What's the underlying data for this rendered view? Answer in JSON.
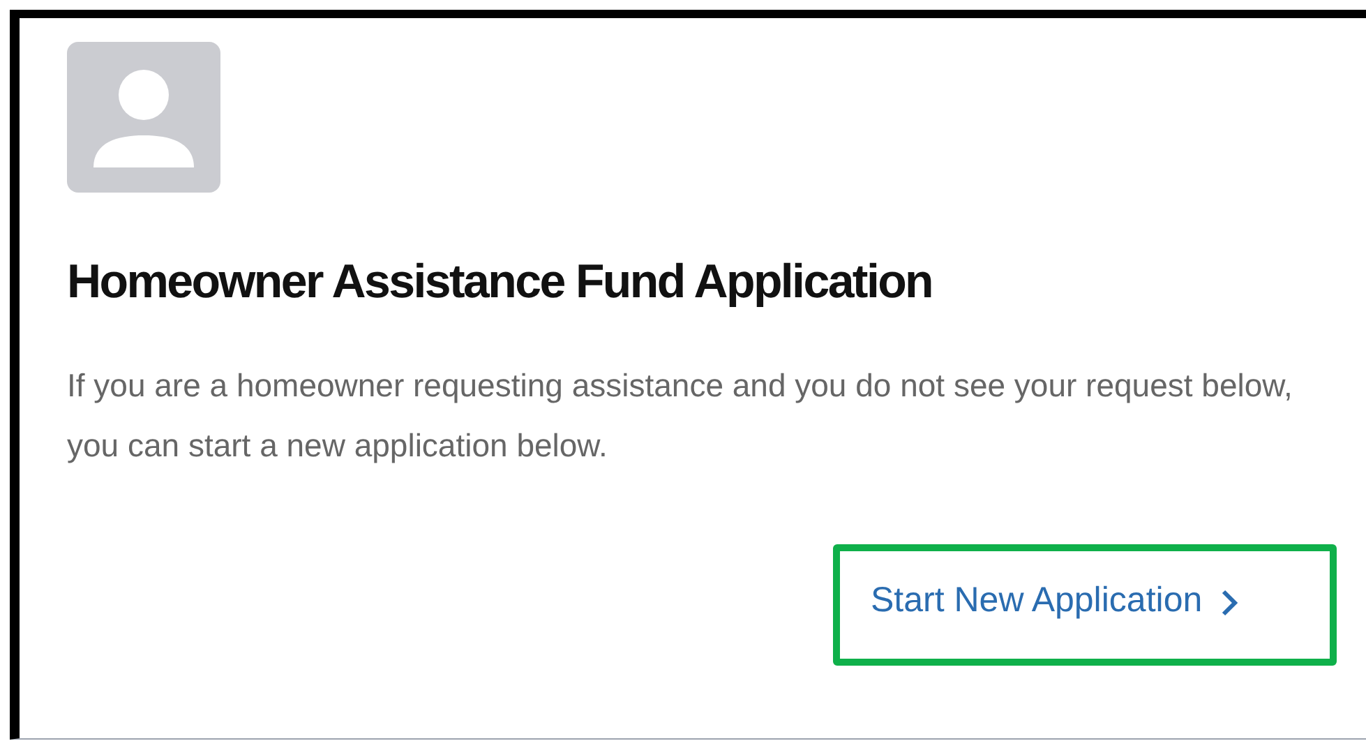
{
  "card": {
    "title": "Homeowner Assistance Fund Application",
    "description": "If you are a homeowner requesting assistance and you do not see your request below, you can start a new application below.",
    "action": {
      "label": "Start New Application",
      "highlighted": true
    }
  }
}
